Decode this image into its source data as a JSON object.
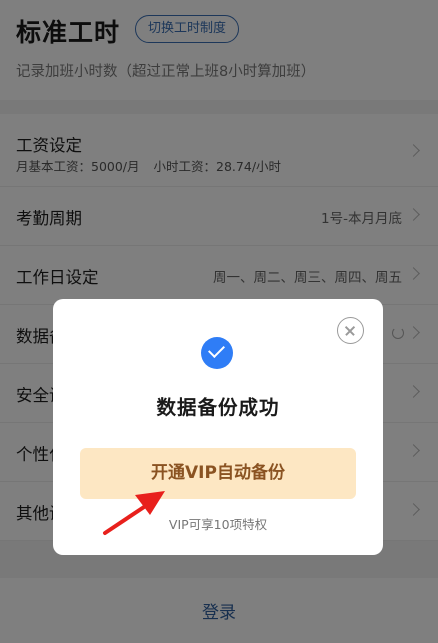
{
  "header": {
    "title": "标准工时",
    "switch_label": "切换工时制度",
    "subtitle": "记录加班小时数（超过正常上班8小时算加班）"
  },
  "settings": {
    "salary": {
      "label": "工资设定",
      "base_pay": "月基本工资：5000/月",
      "hourly_pay": "小时工资：28.74/小时"
    },
    "attendance": {
      "label": "考勤周期",
      "value": "1号-本月月底"
    },
    "workdays": {
      "label": "工作日设定",
      "value": "周一、周二、周三、周四、周五"
    },
    "data_backup": {
      "label": "数据备"
    },
    "security": {
      "label": "安全设"
    },
    "personalize": {
      "label": "个性化"
    },
    "other": {
      "label": "其他设"
    }
  },
  "footer": {
    "login_label": "登录"
  },
  "modal": {
    "title": "数据备份成功",
    "vip_button": "开通VIP自动备份",
    "vip_note": "VIP可享10项特权",
    "icons": {
      "close": "close-icon",
      "success": "check-circle-icon"
    }
  },
  "colors": {
    "accent": "#2f7df6",
    "link": "#3a6fb4",
    "vip_bg": "#fde7c3",
    "vip_text": "#8a5322",
    "arrow": "#e8201c"
  }
}
